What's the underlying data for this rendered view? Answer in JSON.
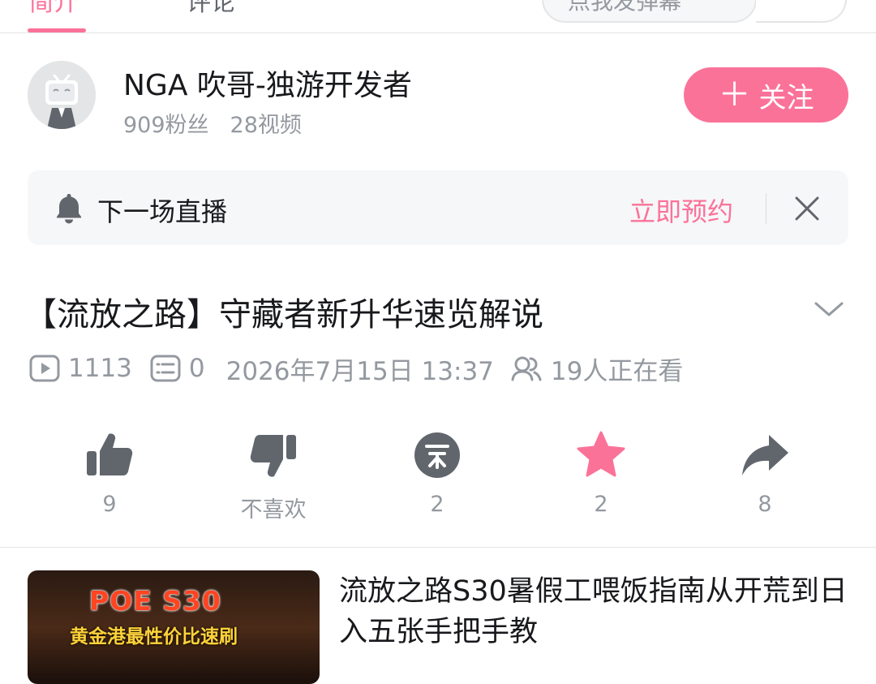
{
  "tabs": [
    {
      "label": "简介",
      "active": true
    },
    {
      "label": "评论",
      "active": false
    }
  ],
  "danmaku": {
    "placeholder": "点我发弹幕"
  },
  "uploader": {
    "name": "NGA 吹哥-独游开发者",
    "fans": "909粉丝",
    "videos": "28视频",
    "follow_label": "关注",
    "follow_icon": "plus-icon"
  },
  "live_banner": {
    "text": "下一场直播",
    "reserve_label": "立即预约",
    "icon": "bell-icon"
  },
  "video": {
    "title": "【流放之路】守藏者新升华速览解说",
    "plays": "1113",
    "danmaku_count": "0",
    "datetime": "2026年7月15日 13:37",
    "watching": "19人正在看"
  },
  "actions": [
    {
      "name": "like",
      "icon": "thumb-up-icon",
      "label": "9"
    },
    {
      "name": "dislike",
      "icon": "thumb-down-icon",
      "label": "不喜欢"
    },
    {
      "name": "coin",
      "icon": "coin-icon",
      "label": "2"
    },
    {
      "name": "favorite",
      "icon": "star-icon",
      "label": "2"
    },
    {
      "name": "share",
      "icon": "share-icon",
      "label": "8"
    }
  ],
  "related": {
    "title": "流放之路S30暑假工喂饭指南从开荒到日入五张手把手教",
    "thumb_line1": "POE S30",
    "thumb_line2": "黄金港最性价比速刷"
  },
  "colors": {
    "accent": "#fb7299",
    "icon_gray": "#61666d",
    "text_secondary": "#9499a0"
  }
}
